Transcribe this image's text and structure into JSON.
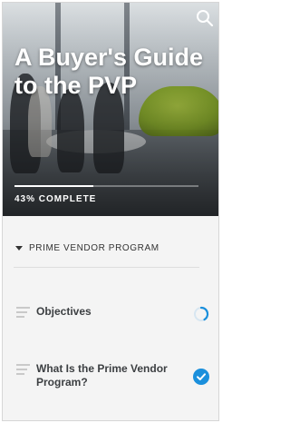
{
  "header": {
    "course_title": "A Buyer's Guide to the PVP",
    "progress_percent": 43,
    "progress_text": "43% COMPLETE",
    "search_icon": "search-icon"
  },
  "outline": {
    "section_label": "PRIME VENDOR PROGRAM",
    "lessons": [
      {
        "title": "Objectives",
        "status": "in-progress",
        "status_icon": "partial-progress-ring-icon"
      },
      {
        "title": "What Is the Prime Vendor Program?",
        "status": "complete",
        "status_icon": "checkmark-circle-icon"
      }
    ]
  },
  "colors": {
    "accent": "#1a8fdc",
    "progress_fill": "#ffffff",
    "text_dark": "#3c3f42"
  }
}
